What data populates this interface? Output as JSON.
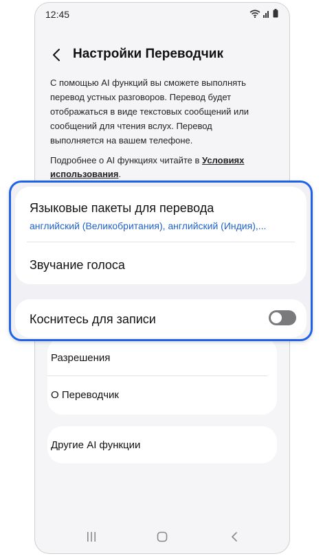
{
  "status_bar": {
    "time": "12:45"
  },
  "header": {
    "title": "Настройки Переводчик"
  },
  "description": "С помощью AI функций вы сможете выполнять перевод устных разговоров. Перевод будет отображаться в виде текстовых сообщений или сообщений для чтения вслух. Перевод выполняется на вашем телефоне.",
  "more_info": {
    "prefix": "Подробнее о AI функциях читайте в ",
    "link": "Условиях использования",
    "suffix": "."
  },
  "settings": {
    "language_packs": {
      "label": "Языковые пакеты для перевода",
      "value": "английский (Великобритания), английский (Индия),..."
    },
    "voice": {
      "label": "Звучание голоса"
    },
    "tap_to_record": {
      "label": "Коснитесь для записи",
      "enabled": false
    },
    "permissions": {
      "label": "Разрешения"
    },
    "about": {
      "label": "О Переводчик"
    },
    "other_ai": {
      "label": "Другие AI функции"
    }
  },
  "colors": {
    "accent": "#1f62e8",
    "link": "#1f62c8",
    "toggle_off": "#7a7a7c",
    "background": "#f5f5f7"
  }
}
